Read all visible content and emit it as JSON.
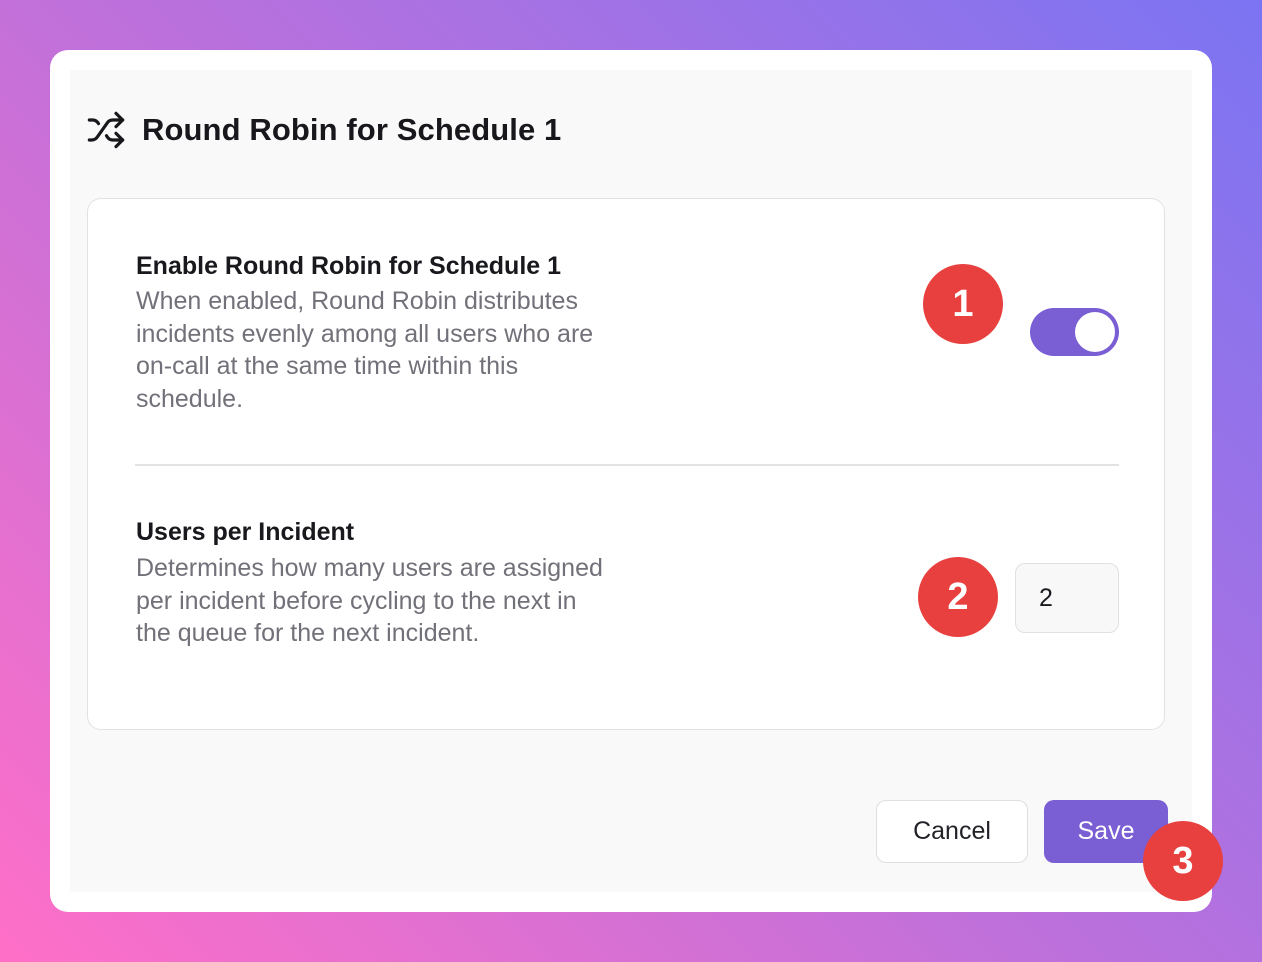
{
  "modal": {
    "title": "Round Robin for Schedule 1",
    "title_icon": "shuffle-icon"
  },
  "settings": [
    {
      "title": "Enable Round Robin for Schedule 1",
      "description": "When enabled, Round Robin distributes incidents evenly among all users who are on-call at the same time within this schedule.",
      "control": "toggle",
      "enabled": true
    },
    {
      "title": "Users per Incident",
      "description": "Determines how many users are assigned per incident before cycling to the next in the queue for the next incident.",
      "control": "number",
      "value": "2"
    }
  ],
  "footer": {
    "cancel_label": "Cancel",
    "save_label": "Save"
  },
  "annotations": [
    "1",
    "2",
    "3"
  ],
  "colors": {
    "accent": "#7a5ed3",
    "badge": "#e8403f",
    "background_gradient_start": "#ff6fc7",
    "background_gradient_end": "#7b74f2"
  }
}
